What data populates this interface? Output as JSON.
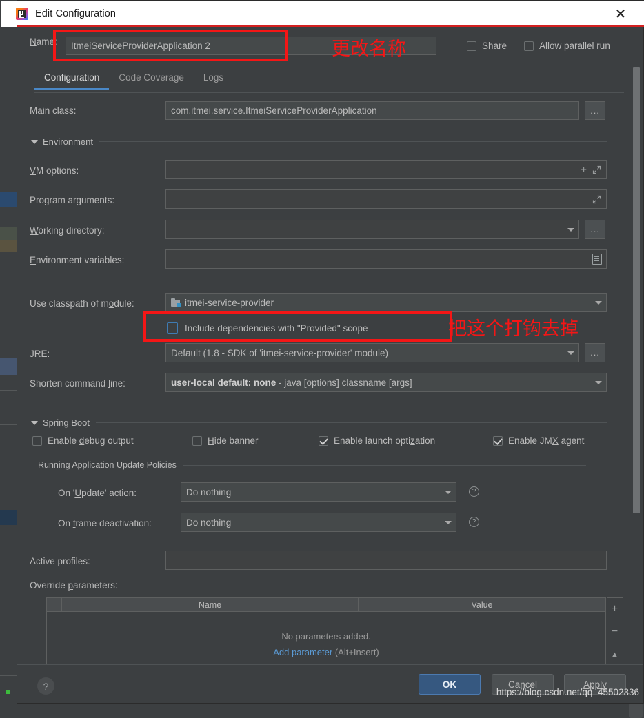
{
  "window": {
    "title": "Edit Configuration",
    "app_icon": "intellij-idea-icon",
    "close_label": "✕"
  },
  "name_row": {
    "label": "Name:",
    "label_mnemonic": "N",
    "value": "ItmeiServiceProviderApplication 2",
    "share": {
      "label": "Share",
      "checked": false
    },
    "allow_parallel": {
      "label": "Allow parallel run",
      "checked": false
    }
  },
  "annotations": [
    {
      "text": "更改名称",
      "meaning": "change-the-name"
    },
    {
      "text": "把这个打钩去掉",
      "meaning": "uncheck-this-checkbox"
    }
  ],
  "tabs": [
    {
      "label": "Configuration",
      "active": true
    },
    {
      "label": "Code Coverage",
      "active": false
    },
    {
      "label": "Logs",
      "active": false
    }
  ],
  "fields": {
    "main_class": {
      "label": "Main class:",
      "value": "com.itmei.service.ItmeiServiceProviderApplication",
      "browse": "..."
    },
    "vm_options": {
      "label": "VM options:",
      "value": ""
    },
    "program_arguments": {
      "label": "Program arguments:",
      "value": ""
    },
    "working_directory": {
      "label": "Working directory:",
      "value": "",
      "browse": "..."
    },
    "environment_variables": {
      "label": "Environment variables:",
      "value": ""
    },
    "use_classpath": {
      "label": "Use classpath of module:",
      "value": "itmei-service-provider"
    },
    "include_provided": {
      "label": "Include dependencies with \"Provided\" scope",
      "checked": false
    },
    "jre": {
      "label": "JRE:",
      "value": "Default (1.8 - SDK of 'itmei-service-provider' module)",
      "browse": "..."
    },
    "shorten_command_line": {
      "label": "Shorten command line:",
      "value_strong": "user-local default: none",
      "value_rest": " - java [options] classname [args]"
    },
    "active_profiles": {
      "label": "Active profiles:",
      "value": ""
    },
    "override_parameters": {
      "label": "Override parameters:"
    }
  },
  "sections": {
    "environment": "Environment",
    "spring_boot": "Spring Boot",
    "update_policies": "Running Application Update Policies"
  },
  "spring_boot_checkboxes": [
    {
      "label": "Enable debug output",
      "checked": false
    },
    {
      "label": "Hide banner",
      "checked": false
    },
    {
      "label": "Enable launch optimization",
      "checked": true
    },
    {
      "label": "Enable JMX agent",
      "checked": true
    }
  ],
  "update_policies": [
    {
      "label": "On 'Update' action:",
      "value": "Do nothing",
      "help": "?"
    },
    {
      "label": "On frame deactivation:",
      "value": "Do nothing",
      "help": "?"
    }
  ],
  "parameters_table": {
    "columns": [
      "",
      "Name",
      "Value"
    ],
    "rows": [],
    "empty_text": "No parameters added.",
    "add_link": "Add parameter",
    "add_hint": " (Alt+Insert)",
    "buttons": [
      "+",
      "−",
      "▲"
    ]
  },
  "footer": {
    "help": "?",
    "ok": "OK",
    "cancel": "Cancel",
    "apply": "Apply"
  },
  "watermark": "https://blog.csdn.net/qq_45502336",
  "colors": {
    "accent": "#4a88c7",
    "ok_button": "#365880",
    "annotation_red": "#f41616",
    "link_blue": "#5b9bd5",
    "dialog_bg": "#3c3f41"
  }
}
